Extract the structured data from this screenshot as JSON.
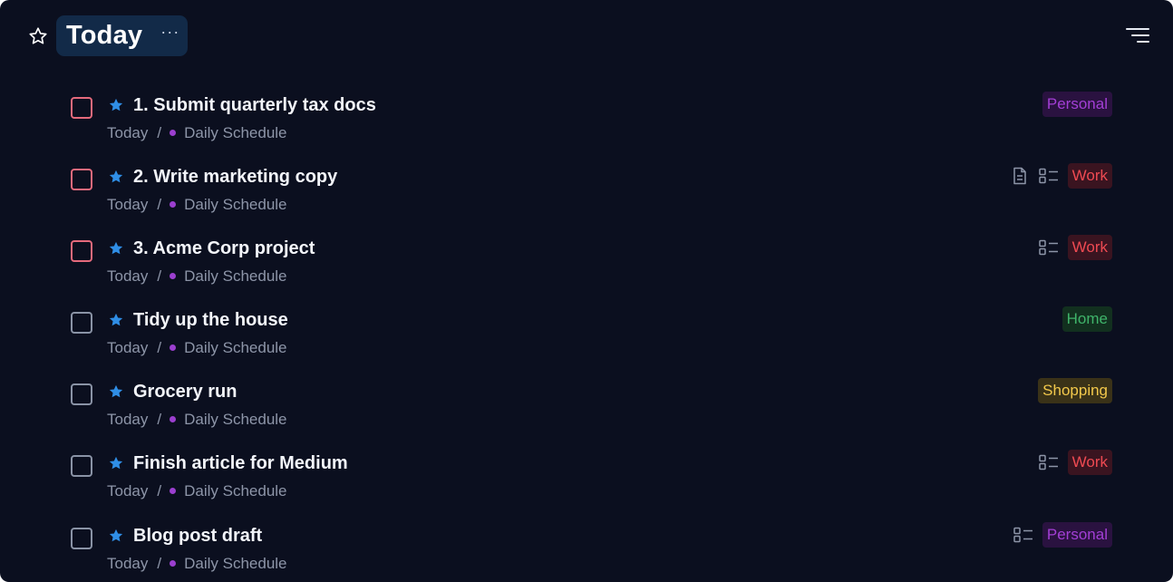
{
  "header": {
    "title": "Today",
    "more_label": "···"
  },
  "colors": {
    "background": "#0b0f1f",
    "accent_star": "#2f8ee6",
    "priority_checkbox": "#e56a7c",
    "normal_checkbox": "#8a93a6",
    "project_dot": "#9b3fcf"
  },
  "tag_styles": {
    "Personal": {
      "fg": "#a33fd6",
      "bg": "#2a1240"
    },
    "Work": {
      "fg": "#ef4a52",
      "bg": "#3a1420"
    },
    "Home": {
      "fg": "#3fb36a",
      "bg": "#12301f"
    },
    "Shopping": {
      "fg": "#f2c84b",
      "bg": "#3a3218"
    }
  },
  "tasks": [
    {
      "title": "1. Submit quarterly tax docs",
      "date": "Today",
      "separator": "/",
      "project": "Daily Schedule",
      "priority": true,
      "icons": [],
      "tag": "Personal"
    },
    {
      "title": "2. Write marketing copy",
      "date": "Today",
      "separator": "/",
      "project": "Daily Schedule",
      "priority": true,
      "icons": [
        "note-icon",
        "checklist-icon"
      ],
      "tag": "Work"
    },
    {
      "title": "3. Acme Corp project",
      "date": "Today",
      "separator": "/",
      "project": "Daily Schedule",
      "priority": true,
      "icons": [
        "checklist-icon"
      ],
      "tag": "Work"
    },
    {
      "title": "Tidy up the house",
      "date": "Today",
      "separator": "/",
      "project": "Daily Schedule",
      "priority": false,
      "icons": [],
      "tag": "Home"
    },
    {
      "title": "Grocery run",
      "date": "Today",
      "separator": "/",
      "project": "Daily Schedule",
      "priority": false,
      "icons": [],
      "tag": "Shopping"
    },
    {
      "title": "Finish article for Medium",
      "date": "Today",
      "separator": "/",
      "project": "Daily Schedule",
      "priority": false,
      "icons": [
        "checklist-icon"
      ],
      "tag": "Work"
    },
    {
      "title": "Blog post draft",
      "date": "Today",
      "separator": "/",
      "project": "Daily Schedule",
      "priority": false,
      "icons": [
        "checklist-icon"
      ],
      "tag": "Personal"
    }
  ]
}
